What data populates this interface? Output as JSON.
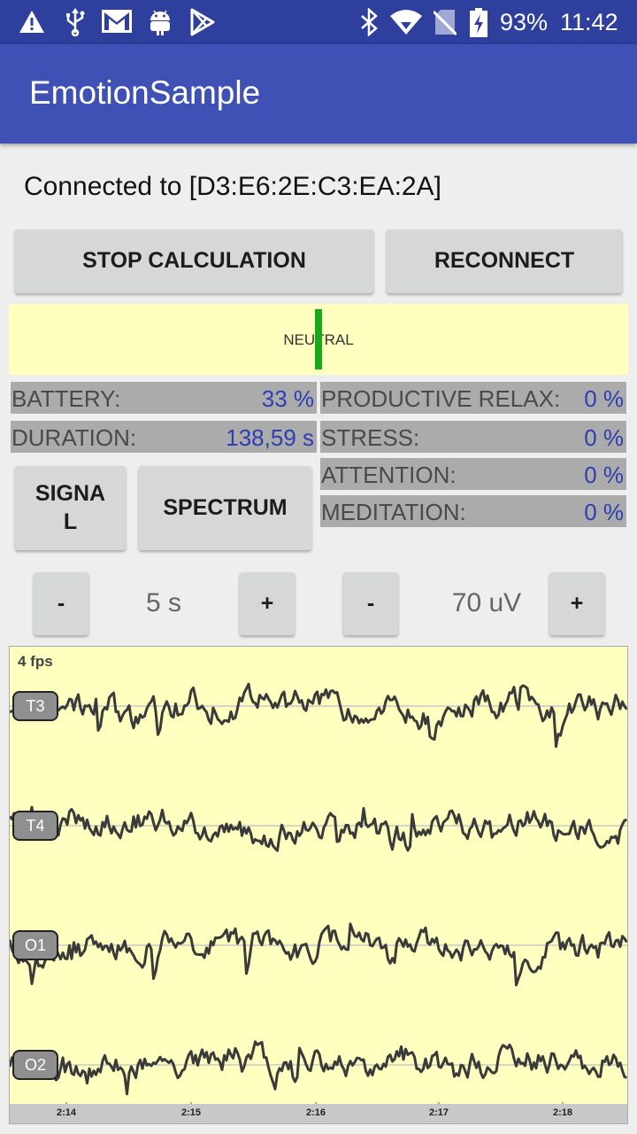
{
  "status_bar": {
    "battery": "93%",
    "time": "11:42",
    "icons": [
      "alert-icon",
      "usb-icon",
      "gmail-icon",
      "android-icon",
      "play-store-icon",
      "bluetooth-icon",
      "wifi-icon",
      "no-sim-icon",
      "battery-charging-icon"
    ]
  },
  "app_bar": {
    "title": "EmotionSample"
  },
  "connection": {
    "text": "Connected to [D3:E6:2E:C3:EA:2A]"
  },
  "buttons": {
    "stop_calculation": "STOP CALCULATION",
    "reconnect": "RECONNECT",
    "signal": "SIGNA\nL",
    "spectrum": "SPECTRUM"
  },
  "emotion": {
    "label": "NEUTRAL",
    "marker_color": "#18a818"
  },
  "stats_left": [
    {
      "label": "BATTERY:",
      "value": "33 %"
    },
    {
      "label": "DURATION:",
      "value": "138,59 s"
    }
  ],
  "stats_right": [
    {
      "label": "PRODUCTIVE RELAX:",
      "value": "0 %"
    },
    {
      "label": "STRESS:",
      "value": "0 %"
    },
    {
      "label": "ATTENTION:",
      "value": "0 %"
    },
    {
      "label": "MEDITATION:",
      "value": "0 %"
    }
  ],
  "time_scale": {
    "minus": "-",
    "value": "5 s",
    "plus": "+"
  },
  "amplitude_scale": {
    "minus": "-",
    "value": "70 uV",
    "plus": "+"
  },
  "graph": {
    "fps": "4 fps",
    "background": "#ffffc0",
    "trace_color": "#3a3a3a",
    "channels": [
      "T3",
      "T4",
      "O1",
      "O2"
    ],
    "time_ticks": [
      "2:14",
      "2:15",
      "2:16",
      "2:17",
      "2:18"
    ]
  },
  "colors": {
    "primary": "#3f51b5",
    "primary_dark": "#2f3f9e",
    "value_text": "#2c3eb2"
  }
}
